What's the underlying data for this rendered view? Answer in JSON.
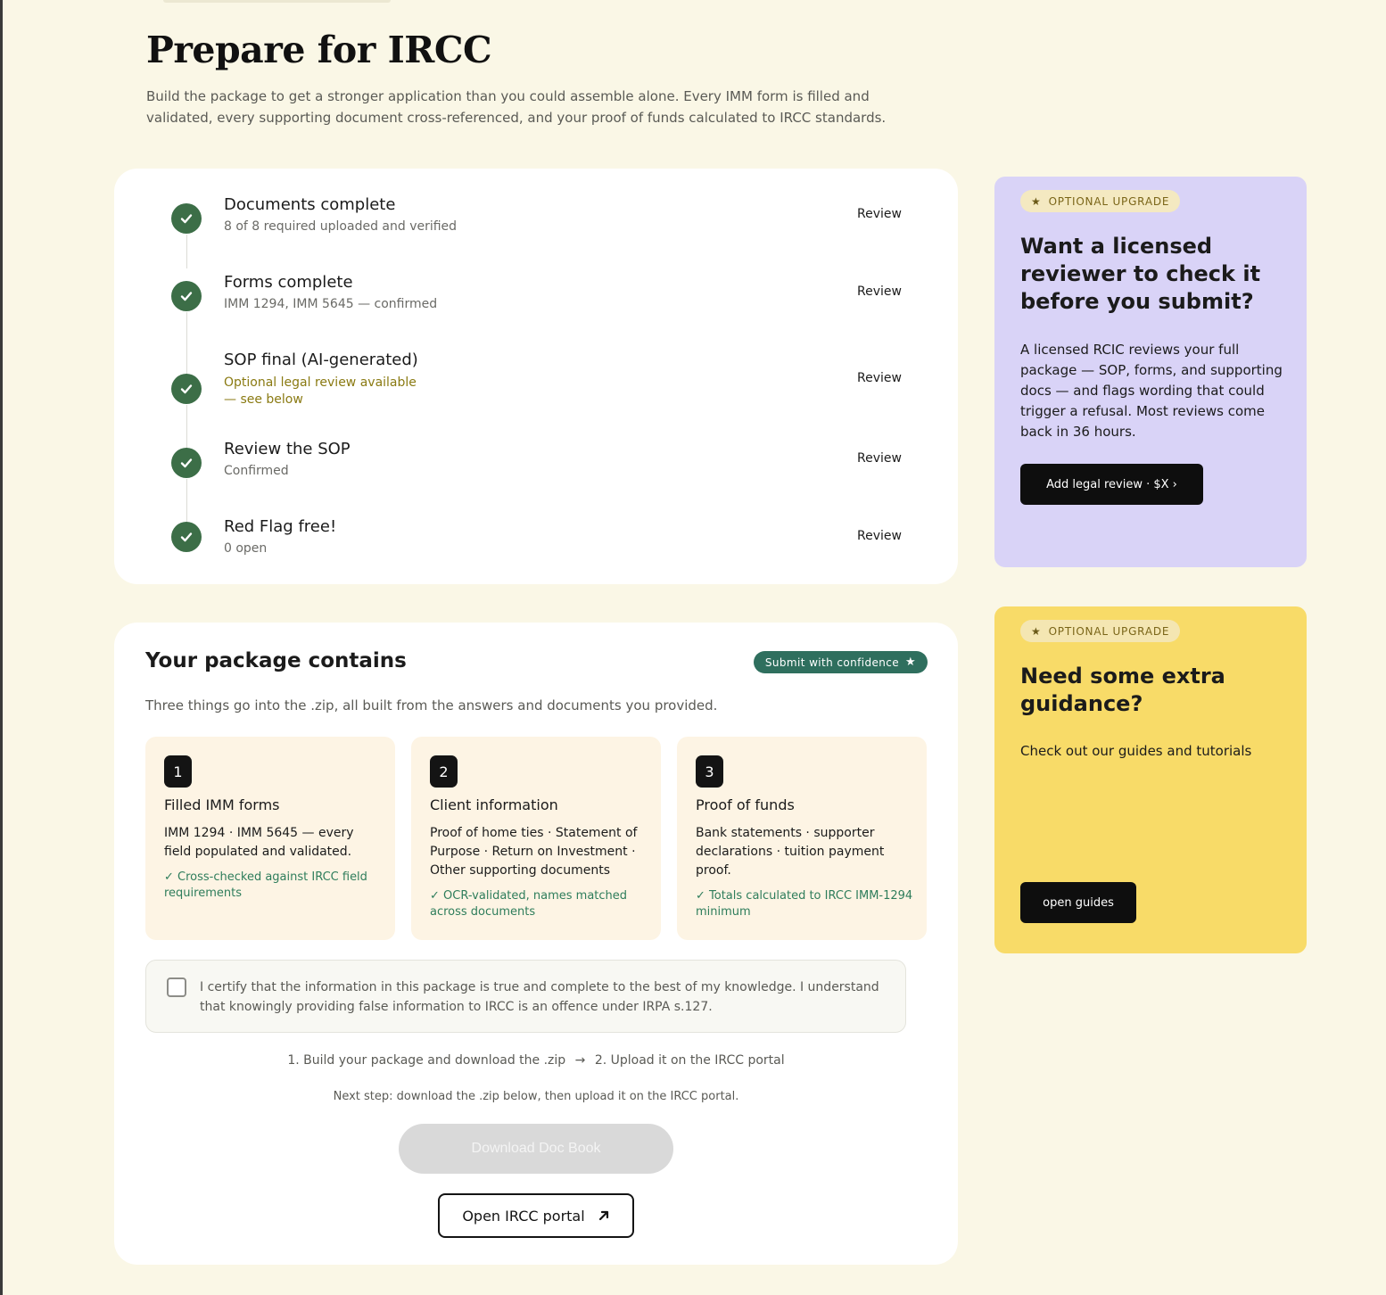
{
  "header": {
    "title": "Prepare for IRCC",
    "subtitle": "Build the package to get a stronger application than you could assemble alone. Every IMM form is filled and validated, every supporting document cross-referenced, and your proof of funds calculated to IRCC standards."
  },
  "checklist": {
    "review_label": "Review",
    "steps": [
      {
        "title": "Documents complete",
        "sub": "8 of 8 required uploaded and verified"
      },
      {
        "title": "Forms complete",
        "sub": "IMM 1294, IMM 5645 — confirmed"
      },
      {
        "title": "SOP final (AI-generated)",
        "sub_line1": "Optional legal review available",
        "sub_line2": "— see below"
      },
      {
        "title": "Review the SOP",
        "sub": "Confirmed"
      },
      {
        "title": "Red Flag free!",
        "sub": "0 open"
      }
    ]
  },
  "package": {
    "title": "Your package contains",
    "badge": "Submit with confidence",
    "description": "Three things go into the .zip, all built from the answers and documents you provided.",
    "items": [
      {
        "number": "1",
        "title": "Filled IMM forms",
        "body": "IMM 1294 · IMM 5645 — every field populated and validated.",
        "note": "✓ Cross-checked against IRCC field requirements"
      },
      {
        "number": "2",
        "title": "Client information",
        "body": "Proof of home ties · Statement of Purpose · Return on Investment · Other supporting documents",
        "note": "✓ OCR-validated, names matched across documents"
      },
      {
        "number": "3",
        "title": "Proof of funds",
        "body": "Bank statements · supporter declarations · tuition payment proof.",
        "note": "✓ Totals calculated to IRCC IMM-1294 minimum"
      }
    ],
    "certify_text": "I certify that the information in this package is true and complete to the best of my knowledge. I understand that knowingly providing false information to IRCC is an offence under IRPA s.127.",
    "certify_checked": false,
    "flow_step1": "1.  Build your package and download the .zip",
    "flow_arrow": "→",
    "flow_step2": "2.  Upload it on the IRCC portal",
    "next_step": "Next step: download the .zip below, then upload it on the IRCC portal.",
    "download_label": "Download Doc Book",
    "portal_label": "Open IRCC portal"
  },
  "reviewer_card": {
    "pill": "OPTIONAL UPGRADE",
    "title": "Want a licensed reviewer to check it before you submit?",
    "body": "A licensed RCIC reviews your full package — SOP, forms, and supporting docs — and flags wording that could trigger a refusal. Most reviews come back in 36 hours.",
    "button": "Add legal review · $X ›",
    "color": "#d9d3f7"
  },
  "guidance_card": {
    "pill": "OPTIONAL UPGRADE",
    "title": "Need some extra guidance?",
    "body": "Check out our guides and tutorials",
    "button": "open guides",
    "color": "#f8db68"
  },
  "colors": {
    "background": "#faf7e6",
    "check_green": "#3c6e47",
    "badge_green": "#2f6f5e",
    "note_green": "#2e7d5b",
    "warn_text": "#8a7a12"
  },
  "icons": {
    "step_status": "check-circle-icon",
    "badge": "star-icon",
    "portal": "arrow-up-right-icon"
  }
}
